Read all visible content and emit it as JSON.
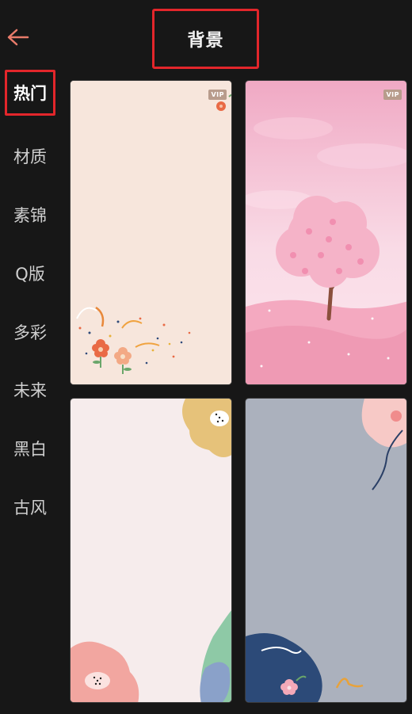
{
  "header": {
    "title": "背景",
    "back_icon": "back-arrow-icon",
    "accent_color": "#e3262b"
  },
  "sidebar": {
    "items": [
      {
        "label": "热门",
        "active": true
      },
      {
        "label": "材质"
      },
      {
        "label": "素锦"
      },
      {
        "label": "Q版"
      },
      {
        "label": "多彩"
      },
      {
        "label": "未来"
      },
      {
        "label": "黑白"
      },
      {
        "label": "古风"
      }
    ]
  },
  "grid": {
    "cards": [
      {
        "name": "cream-floral",
        "vip": "VIP"
      },
      {
        "name": "pink-cherry-tree",
        "vip": "VIP"
      },
      {
        "name": "blush-flowers"
      },
      {
        "name": "gray-blue-flowers"
      }
    ]
  }
}
